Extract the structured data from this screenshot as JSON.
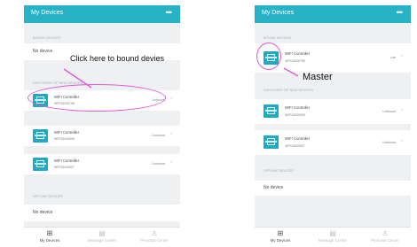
{
  "left": {
    "title": "My Devices",
    "more": "•••",
    "bound_header": "BOUND DEVICES",
    "bound_empty": "No device",
    "discovery_header": "DISCOVERY OF NEW DEVICES",
    "devices": [
      {
        "name": "WIFI Controller",
        "id": "WFE34006798",
        "status": "Unbound"
      },
      {
        "name": "WIFI Controller",
        "id": "WFE34006508",
        "status": "Unbound"
      },
      {
        "name": "WIFI Controller",
        "id": "WFE34006537",
        "status": "Unbound"
      }
    ],
    "offline_header": "OFFLINE DEVICES",
    "offline_empty": "No device",
    "tabs": [
      "My Devices",
      "Message Center",
      "Personal Center"
    ]
  },
  "right": {
    "title": "My Devices",
    "more": "•••",
    "bound_header": "BOUND DEVICES",
    "bound_device": {
      "name": "WIFI Controller",
      "id": "WFE34006798",
      "status": "Lan"
    },
    "discovery_header": "DISCOVERY OF NEW DEVICES",
    "devices": [
      {
        "name": "WIFI Controller",
        "id": "WFE34006508",
        "status": "Unbound"
      },
      {
        "name": "WIFI Controller",
        "id": "WFE34006537",
        "status": "Unbound"
      }
    ],
    "offline_header": "OFFLINE DEVICES",
    "offline_empty": "No device",
    "tabs": [
      "My Devices",
      "Message Center",
      "Personal Center"
    ]
  },
  "annotations": {
    "click_hint": "Click here to bound devies",
    "master": "Master"
  },
  "colors": {
    "topbar": "#27b2c5",
    "device_icon": "#1fa9c2",
    "annotation_highlight": "#e15ad8"
  },
  "icons": [
    "grid-icon",
    "message-icon",
    "person-icon",
    "chevron-right-icon",
    "controller-icon"
  ]
}
